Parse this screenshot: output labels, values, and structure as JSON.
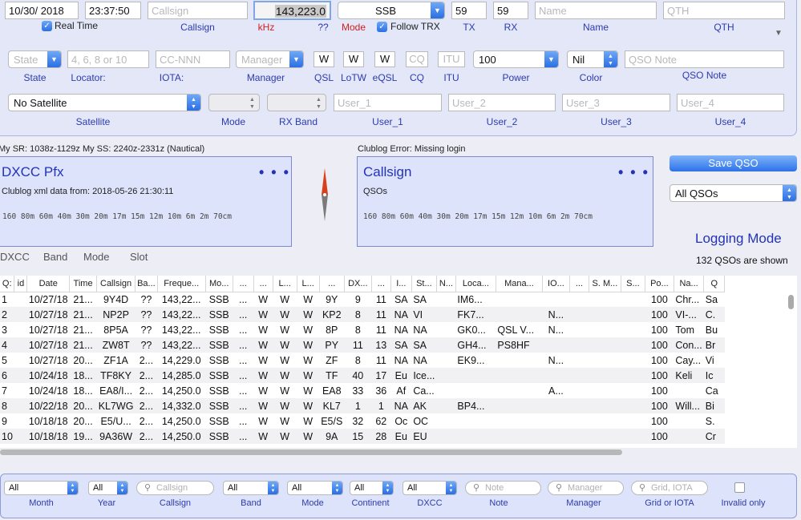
{
  "top": {
    "date": "10/30/ 2018",
    "time": "23:37:50",
    "real_time_label": "Real Time",
    "callsign_placeholder": "Callsign",
    "callsign_label": "Callsign",
    "freq_value": "143,223.0",
    "freq_label": "kHz",
    "qq_label": "??",
    "mode_value": "SSB",
    "mode_label": "Mode",
    "follow_trx_label": "Follow TRX",
    "tx_value": "59",
    "tx_label": "TX",
    "rx_value": "59",
    "rx_label": "RX",
    "name_placeholder": "Name",
    "name_label": "Name",
    "qth_placeholder": "QTH",
    "qth_label": "QTH"
  },
  "row2": {
    "state_placeholder": "State",
    "state_label": "State",
    "locator_placeholder": "4, 6, 8 or 10",
    "locator_label": "Locator:",
    "iota_placeholder": "CC-NNN",
    "iota_label": "IOTA:",
    "manager_placeholder": "Manager",
    "manager_label": "Manager",
    "qsl_value": "W",
    "qsl_label": "QSL",
    "lotw_value": "W",
    "lotw_label": "LoTW",
    "eqsl_value": "W",
    "eqsl_label": "eQSL",
    "cq_placeholder": "CQ",
    "cq_label": "CQ",
    "itu_placeholder": "ITU",
    "itu_label": "ITU",
    "power_value": "100",
    "power_label": "Power",
    "color_value": "Nil",
    "color_label": "Color",
    "qso_note_placeholder": "QSO Note",
    "qso_note_label": "QSO Note"
  },
  "row3": {
    "satellite_value": "No Satellite",
    "satellite_label": "Satellite",
    "mode_label": "Mode",
    "rxband_label": "RX Band",
    "user1_placeholder": "User_1",
    "user1_label": "User_1",
    "user2_placeholder": "User_2",
    "user2_label": "User_2",
    "user3_placeholder": "User_3",
    "user3_label": "User_3",
    "user4_placeholder": "User_4",
    "user4_label": "User_4"
  },
  "status": {
    "sr_ss": "My SR: 1038z-1129z  My SS: 2240z-2331z (Nautical)",
    "clublog_error": "Clublog Error: Missing login"
  },
  "dxcc_panel": {
    "title": "DXCC Pfx",
    "dots": "• • •",
    "info": "Clublog xml data from: 2018-05-26 21:30:11",
    "bands": "160  80m  60m  40m  30m  20m  17m  15m  12m  10m   6m   2m  70cm"
  },
  "call_panel": {
    "title": "Callsign",
    "dots": "• • •",
    "info": "QSOs",
    "bands": "160  80m  60m  40m  30m  20m  17m  15m  12m  10m   6m   2m  70cm"
  },
  "right": {
    "save_label": "Save QSO",
    "qso_filter": "All QSOs",
    "mode_title": "Logging Mode",
    "shown": "132 QSOs are shown"
  },
  "tabs": [
    "DXCC",
    "Band",
    "Mode",
    "Slot"
  ],
  "table": {
    "headers": [
      "Q:",
      "id",
      "Date",
      "Time",
      "Callsign",
      "Ba...",
      "Freque...",
      "Mo...",
      "...",
      "...",
      "L...",
      "L...",
      "...",
      "DX...",
      "...",
      "I...",
      "St...",
      "N...",
      "Loca...",
      "Mana...",
      "IO...",
      "...",
      "S. M...",
      "S...",
      "Po...",
      "Na...",
      "Q"
    ],
    "rows": [
      [
        "1",
        "",
        "10/27/18",
        "21...",
        "9Y4D",
        "??",
        "143,22...",
        "SSB",
        "...",
        "W",
        "W",
        "W",
        "9Y",
        "9",
        "11",
        "SA",
        "SA",
        "",
        "IM6...",
        "",
        "",
        "",
        "",
        "",
        "100",
        "Chr...",
        "Sa"
      ],
      [
        "2",
        "",
        "10/27/18",
        "21...",
        "NP2P",
        "??",
        "143,22...",
        "SSB",
        "...",
        "W",
        "W",
        "W",
        "KP2",
        "8",
        "11",
        "NA",
        "VI",
        "",
        "FK7...",
        "",
        "N...",
        "",
        "",
        "",
        "100",
        "VI-...",
        "C."
      ],
      [
        "3",
        "",
        "10/27/18",
        "21...",
        "8P5A",
        "??",
        "143,22...",
        "SSB",
        "...",
        "W",
        "W",
        "W",
        "8P",
        "8",
        "11",
        "NA",
        "NA",
        "",
        "GK0...",
        "QSL V...",
        "N...",
        "",
        "",
        "",
        "100",
        "Tom",
        "Bu"
      ],
      [
        "4",
        "",
        "10/27/18",
        "21...",
        "ZW8T",
        "??",
        "143,22...",
        "SSB",
        "...",
        "W",
        "W",
        "W",
        "PY",
        "11",
        "13",
        "SA",
        "SA",
        "",
        "GH4...",
        "PS8HF",
        "",
        "",
        "",
        "",
        "100",
        "Con...",
        "Br"
      ],
      [
        "5",
        "",
        "10/27/18",
        "20...",
        "ZF1A",
        "2...",
        "14,229.0",
        "SSB",
        "...",
        "W",
        "W",
        "W",
        "ZF",
        "8",
        "11",
        "NA",
        "NA",
        "",
        "EK9...",
        "",
        "N...",
        "",
        "",
        "",
        "100",
        "Cay...",
        "Vi"
      ],
      [
        "6",
        "",
        "10/24/18",
        "18...",
        "TF8KY",
        "2...",
        "14,285.0",
        "SSB",
        "...",
        "W",
        "W",
        "W",
        "TF",
        "40",
        "17",
        "Eu",
        "Ice...",
        "",
        "",
        "",
        "",
        "",
        "",
        "",
        "100",
        "Keli",
        "Ic"
      ],
      [
        "7",
        "",
        "10/24/18",
        "18...",
        "EA8/I...",
        "2...",
        "14,250.0",
        "SSB",
        "...",
        "W",
        "W",
        "W",
        "EA8",
        "33",
        "36",
        "Af",
        "Ca...",
        "",
        "",
        "",
        "A...",
        "",
        "",
        "",
        "100",
        "",
        "Ca"
      ],
      [
        "8",
        "",
        "10/22/18",
        "20...",
        "KL7WG",
        "2...",
        "14,332.0",
        "SSB",
        "...",
        "W",
        "W",
        "W",
        "KL7",
        "1",
        "1",
        "NA",
        "AK",
        "",
        "BP4...",
        "",
        "",
        "",
        "",
        "",
        "100",
        "Will...",
        "Bi"
      ],
      [
        "9",
        "",
        "10/18/18",
        "20...",
        "E5/U...",
        "2...",
        "14,250.0",
        "SSB",
        "...",
        "W",
        "W",
        "W",
        "E5/S",
        "32",
        "62",
        "Oc",
        "OC",
        "",
        "",
        "",
        "",
        "",
        "",
        "",
        "100",
        "",
        "S."
      ],
      [
        "10",
        "",
        "10/18/18",
        "19...",
        "9A36W",
        "2...",
        "14,250.0",
        "SSB",
        "...",
        "W",
        "W",
        "W",
        "9A",
        "15",
        "28",
        "Eu",
        "EU",
        "",
        "",
        "",
        "",
        "",
        "",
        "",
        "100",
        "",
        "Cr"
      ]
    ]
  },
  "filters": {
    "month_value": "All",
    "month_label": "Month",
    "year_value": "All",
    "year_label": "Year",
    "callsign_placeholder": "Callsign",
    "callsign_label": "Callsign",
    "band_value": "All",
    "band_label": "Band",
    "mode_value": "All",
    "mode_label": "Mode",
    "continent_value": "All",
    "continent_label": "Continent",
    "dxcc_value": "All",
    "dxcc_label": "DXCC",
    "note_placeholder": "Note",
    "note_label": "Note",
    "manager_placeholder": "Manager",
    "manager_label": "Manager",
    "grid_placeholder": "Grid, IOTA",
    "grid_label": "Grid or IOTA",
    "invalid_label": "Invalid only"
  }
}
